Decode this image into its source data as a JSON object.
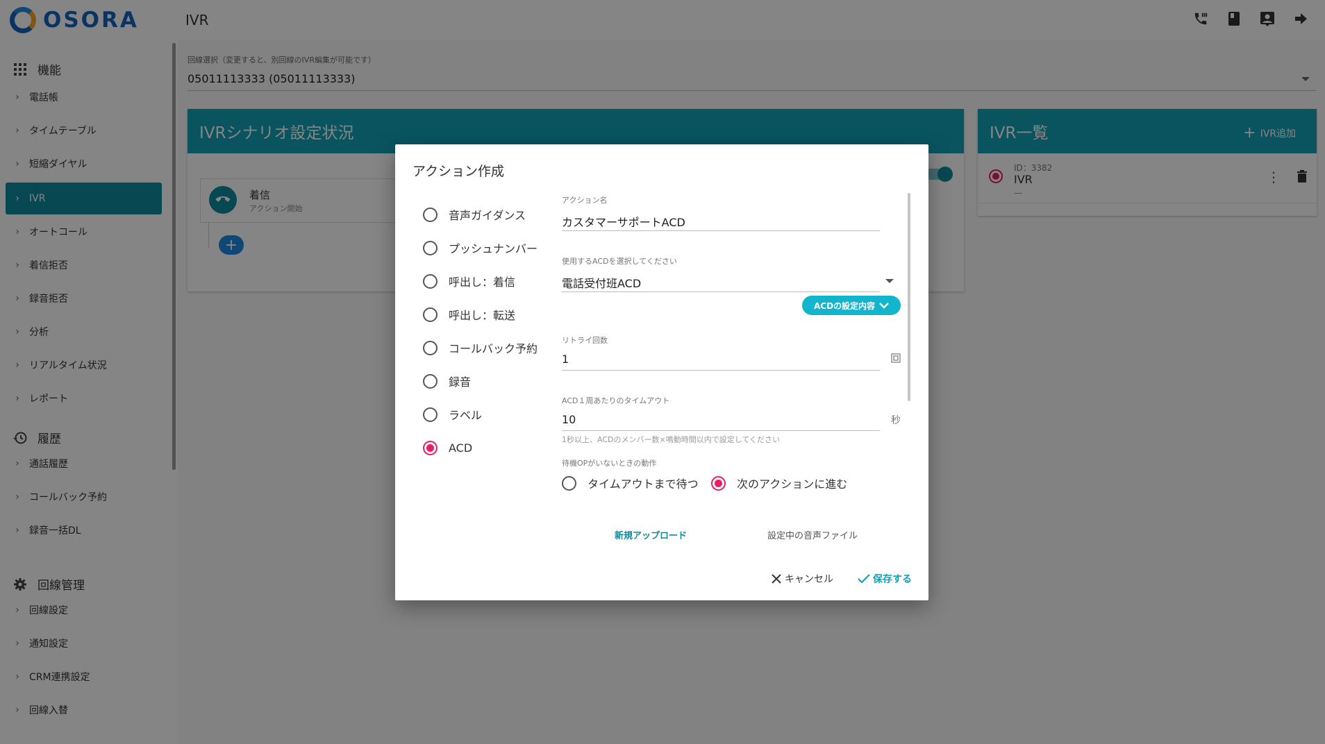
{
  "app": {
    "logo_text": "OSORA",
    "page_title": "IVR"
  },
  "topbar_icons": [
    "phone-settings-icon",
    "book-icon",
    "contact-icon",
    "logout-icon"
  ],
  "sidebar": {
    "sections": [
      {
        "title": "機能",
        "icon": "apps-grid-icon",
        "items": [
          "電話帳",
          "タイムテーブル",
          "短縮ダイヤル",
          "IVR",
          "オートコール",
          "着信拒否",
          "録音拒否",
          "分析",
          "リアルタイム状況",
          "レポート"
        ]
      },
      {
        "title": "履歴",
        "icon": "history-icon",
        "items": [
          "通話履歴",
          "コールバック予約",
          "録音一括DL"
        ]
      },
      {
        "title": "回線管理",
        "icon": "gear-icon",
        "items": [
          "回線設定",
          "通知設定",
          "CRM連携設定",
          "回線入替"
        ]
      }
    ],
    "active_item": "IVR"
  },
  "line_select": {
    "label": "回線選択（変更すると、別回線のIVR編集が可能です）",
    "value": "05011113333 (05011113333)"
  },
  "scenario_card": {
    "title": "IVRシナリオ設定状況",
    "node_title": "着信",
    "node_sub": "アクション開始",
    "add_label": "+"
  },
  "ivr_list": {
    "title": "IVR一覧",
    "add_label": "IVR追加",
    "items": [
      {
        "id_label": "ID：3382",
        "name": "IVR",
        "sub": "—"
      }
    ]
  },
  "dialog": {
    "title": "アクション作成",
    "action_types": [
      "音声ガイダンス",
      "プッシュナンバー",
      "呼出し：着信",
      "呼出し：転送",
      "コールバック予約",
      "録音",
      "ラベル",
      "ACD"
    ],
    "selected_type": "ACD",
    "fields": {
      "action_name": {
        "label": "アクション名",
        "value": "カスタマーサポートACD"
      },
      "acd_select": {
        "label": "使用するACDを選択してください",
        "value": "電話受付班ACD"
      },
      "acd_settings_button": "ACDの設定内容",
      "retry": {
        "label": "リトライ回数",
        "value": "1"
      },
      "timeout": {
        "label": "ACD１周あたりのタイムアウト",
        "value": "10",
        "suffix": "秒",
        "hint": "1秒以上、ACDのメンバー数×鳴動時間以内で設定してください"
      },
      "no_op": {
        "label": "待機OPがいないときの動作",
        "options": [
          "タイムアウトまで待つ",
          "次のアクションに進む"
        ],
        "selected": "次のアクションに進む"
      }
    },
    "upload_label": "新規アップロード",
    "current_file_label": "設定中の音声ファイル",
    "cancel_label": "キャンセル",
    "save_label": "保存する"
  },
  "colors": {
    "primary": "#12a1b5",
    "active_nav": "#118a9e",
    "radio_selected": "#e91e63",
    "logo": "#1565c0"
  }
}
